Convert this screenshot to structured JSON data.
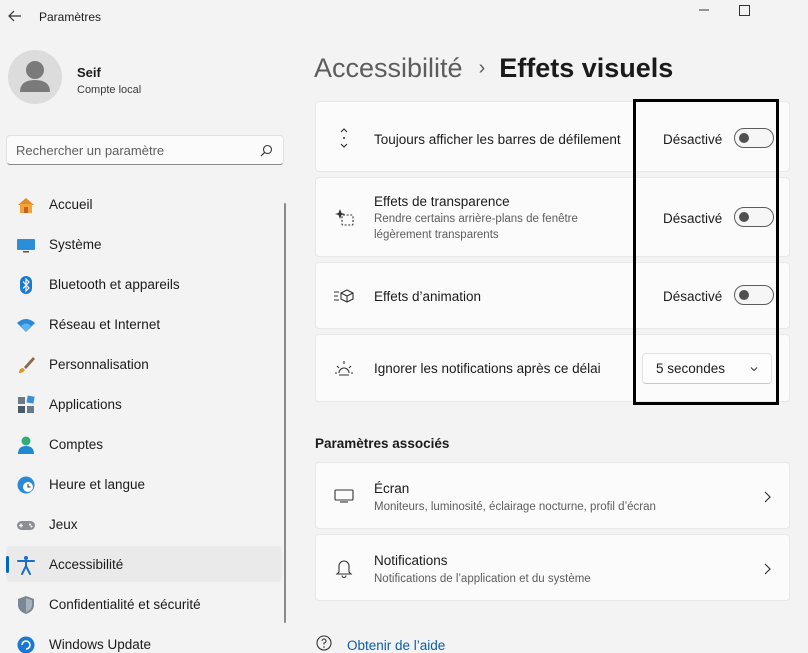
{
  "window": {
    "app_title": "Paramètres",
    "back_icon": "back-arrow-icon",
    "controls": [
      "minimize-icon",
      "maximize-icon"
    ]
  },
  "user": {
    "name": "Seif",
    "account_type": "Compte local"
  },
  "search": {
    "placeholder": "Rechercher un paramètre"
  },
  "sidebar": {
    "items": [
      {
        "label": "Accueil",
        "icon": "home-icon"
      },
      {
        "label": "Système",
        "icon": "display-icon"
      },
      {
        "label": "Bluetooth et appareils",
        "icon": "bluetooth-icon"
      },
      {
        "label": "Réseau et Internet",
        "icon": "wifi-icon"
      },
      {
        "label": "Personnalisation",
        "icon": "paintbrush-icon"
      },
      {
        "label": "Applications",
        "icon": "apps-icon"
      },
      {
        "label": "Comptes",
        "icon": "person-icon"
      },
      {
        "label": "Heure et langue",
        "icon": "clock-globe-icon"
      },
      {
        "label": "Jeux",
        "icon": "gamepad-icon"
      },
      {
        "label": "Accessibilité",
        "icon": "accessibility-icon",
        "active": true
      },
      {
        "label": "Confidentialité et sécurité",
        "icon": "shield-icon"
      },
      {
        "label": "Windows Update",
        "icon": "update-icon"
      }
    ]
  },
  "breadcrumb": {
    "parent": "Accessibilité",
    "separator": "›",
    "current": "Effets visuels"
  },
  "settings": {
    "scrollbars": {
      "title": "Toujours afficher les barres de défilement",
      "state": "Désactivé",
      "on": false,
      "icon": "scroll-arrows-icon"
    },
    "transparency": {
      "title": "Effets de transparence",
      "description": "Rendre certains arrière-plans de fenêtre légèrement transparents",
      "state": "Désactivé",
      "on": false,
      "icon": "transparency-icon"
    },
    "animation": {
      "title": "Effets d’animation",
      "state": "Désactivé",
      "on": false,
      "icon": "animation-icon"
    },
    "notifications_timeout": {
      "title": "Ignorer les notifications après ce délai",
      "selected": "5 secondes",
      "icon": "sun-timer-icon"
    }
  },
  "related": {
    "title": "Paramètres associés",
    "items": [
      {
        "title": "Écran",
        "description": "Moniteurs, luminosité, éclairage nocturne, profil d’écran",
        "icon": "monitor-icon"
      },
      {
        "title": "Notifications",
        "description": "Notifications de l’application et du système",
        "icon": "bell-icon"
      }
    ]
  },
  "help": {
    "label": "Obtenir de l’aide",
    "icon": "help-icon"
  },
  "colors": {
    "accent": "#0067c0",
    "link": "#0a5db0",
    "annotation_box": "#000000"
  }
}
